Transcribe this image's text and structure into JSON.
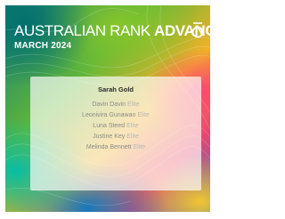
{
  "header": {
    "title_part1": "AUSTRALIAN RANK",
    "title_part2": "ADVANCEMENTS",
    "subtitle": "MARCH 2024"
  },
  "top_advancement": {
    "name": "Sarah Gold"
  },
  "advancements": [
    {
      "name": "Davin Davin",
      "rank": "Elite"
    },
    {
      "name": "Leonivira Gunawan",
      "rank": "Elite"
    },
    {
      "name": "Luna Steed",
      "rank": "Elite"
    },
    {
      "name": "Justine Key",
      "rank": "Elite"
    },
    {
      "name": "Melinda Bennett",
      "rank": "Elite"
    }
  ],
  "colors": {
    "title_text": "#ffffff",
    "name_text": "#8b8b8b",
    "rank_text": "#b7b7b7",
    "top_name_text": "#2b2b2b"
  },
  "icons": {
    "brand_logo": "brand-logo-icon"
  }
}
